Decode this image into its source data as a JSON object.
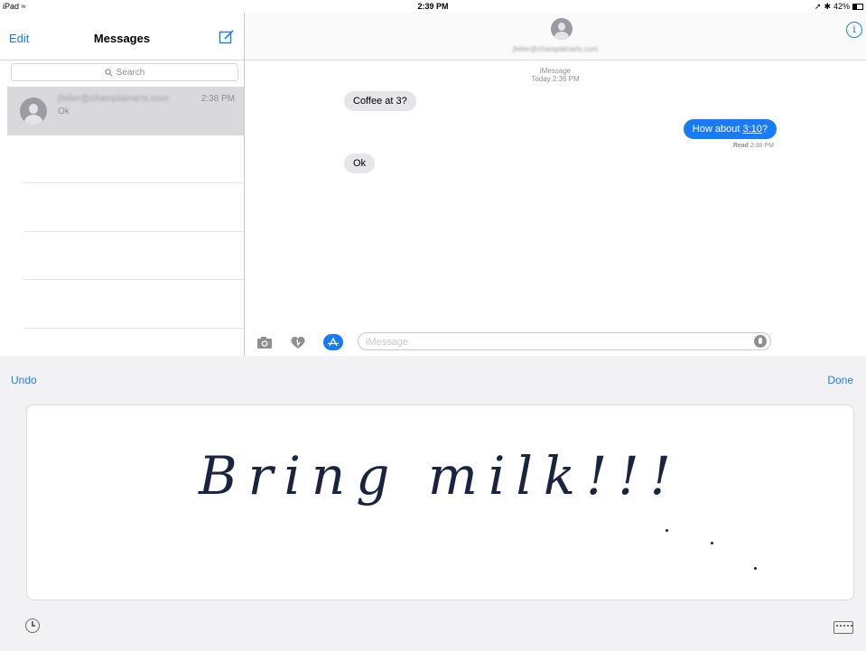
{
  "status_bar": {
    "device": "iPad",
    "wifi_icon": "wifi-icon",
    "time": "2:39 PM",
    "battery": "42%",
    "location_icon": "location-arrow-icon",
    "bluetooth_icon": "bluetooth-icon"
  },
  "sidebar": {
    "edit_label": "Edit",
    "title": "Messages",
    "compose_icon": "compose-icon",
    "search_placeholder": "Search",
    "conversations": [
      {
        "name": "jfeller@champlainarts.com",
        "time": "2:38 PM",
        "preview": "Ok"
      }
    ]
  },
  "chat": {
    "contact": "jfeller@champlainarts.com",
    "info_icon": "info-icon",
    "service": "iMessage",
    "timestamp": "Today 2:36 PM",
    "messages": [
      {
        "direction": "in",
        "text": "Coffee at 3?"
      },
      {
        "direction": "out",
        "text_before": "How about ",
        "link": "3:10",
        "text_after": "?"
      },
      {
        "direction": "in",
        "text": "Ok"
      }
    ],
    "read_label": "Read",
    "read_time": "2:38 PM",
    "input_placeholder": "iMessage"
  },
  "handwriting": {
    "undo_label": "Undo",
    "done_label": "Done",
    "ink_text": "Bring milk!!!",
    "ink_color": "#1a2340"
  },
  "colors": {
    "accent": "#1a7cf5",
    "incoming_bubble": "#e5e5ea",
    "selected_row": "#d9d9dc"
  }
}
